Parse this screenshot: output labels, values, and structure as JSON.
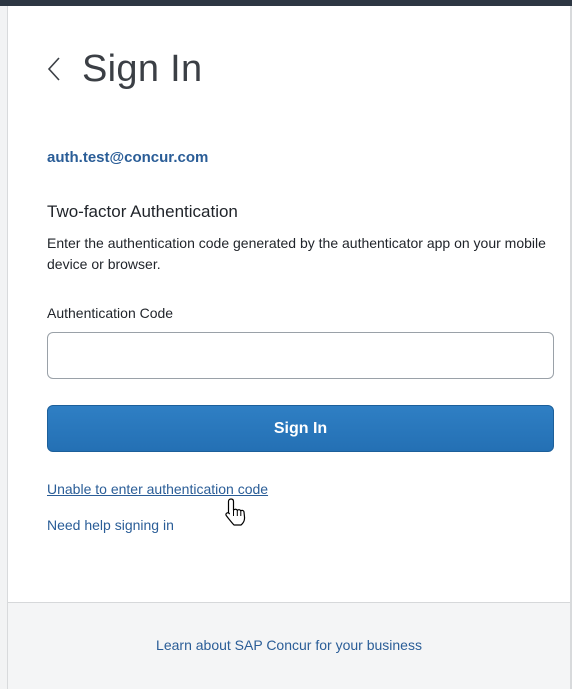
{
  "header": {
    "back_icon": "chevron-left-icon",
    "title": "Sign In"
  },
  "account": {
    "email": "auth.test@concur.com"
  },
  "two_factor": {
    "heading": "Two-factor Authentication",
    "description": "Enter the authentication code generated by the authenticator app on your mobile device or browser."
  },
  "form": {
    "code_label": "Authentication Code",
    "code_value": "",
    "submit_label": "Sign In"
  },
  "links": {
    "unable": "Unable to enter authentication code",
    "help": "Need help signing in"
  },
  "footer": {
    "link": "Learn about SAP Concur for your business"
  },
  "colors": {
    "accent": "#2470b4",
    "link": "#2a5d97",
    "text": "#1f2329"
  },
  "cursor": {
    "icon": "hand-pointer-icon"
  }
}
